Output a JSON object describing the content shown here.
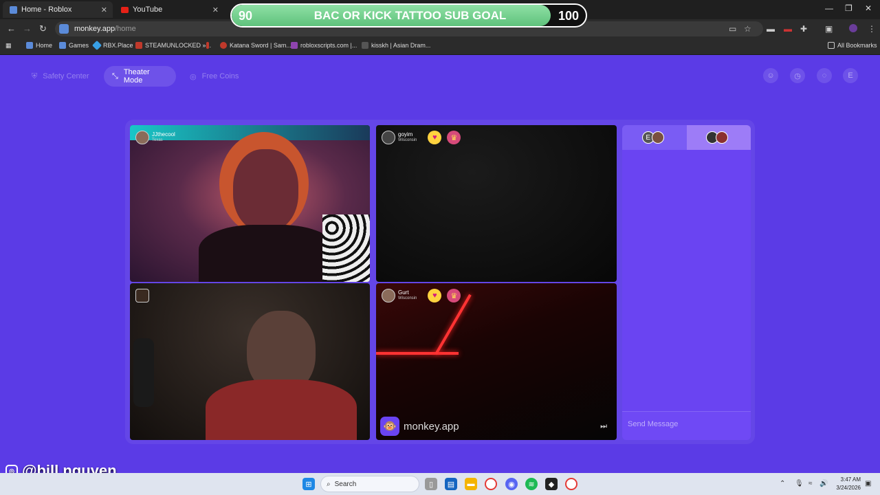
{
  "browser": {
    "tabs": [
      {
        "title": "Home - Roblox"
      },
      {
        "title": "YouTube"
      }
    ],
    "url_host": "monkey.app",
    "url_path": "/home",
    "bookmarks": [
      "Home",
      "Games",
      "RBX.Place",
      "STEAMUNLOCKED »...",
      "Katana Sword | Sam...",
      "robloxscripts.com |...",
      "kisskh | Asian Dram..."
    ],
    "all_bookmarks": "All Bookmarks"
  },
  "goal": {
    "current": "90",
    "target": "100",
    "title": "BAC OR KICK TATTOO SUB GOAL",
    "progress_fraction": 0.9
  },
  "nav": {
    "safety": "Safety Center",
    "theater": "Theater Mode",
    "coins": "Free Coins",
    "profile_initial": "E"
  },
  "tiles": [
    {
      "name": "JJthecool",
      "location": "Texas"
    },
    {
      "name": "goyim",
      "location": "Wisconsin"
    },
    {
      "name": "",
      "location": ""
    },
    {
      "name": "Gurt",
      "location": "Wisconsin"
    }
  ],
  "watermark": "monkey.app",
  "chat": {
    "tab_initial": "E",
    "placeholder": "Send Message"
  },
  "overlay_handle": "@bill.nguyen",
  "taskbar": {
    "search": "Search",
    "time": "3:47 AM",
    "date": "3/24/2026"
  },
  "icons": [
    "roblox-icon",
    "youtube-icon",
    "search-icon",
    "heart-icon",
    "gift-icon",
    "instagram-icon",
    "windows-icon"
  ]
}
